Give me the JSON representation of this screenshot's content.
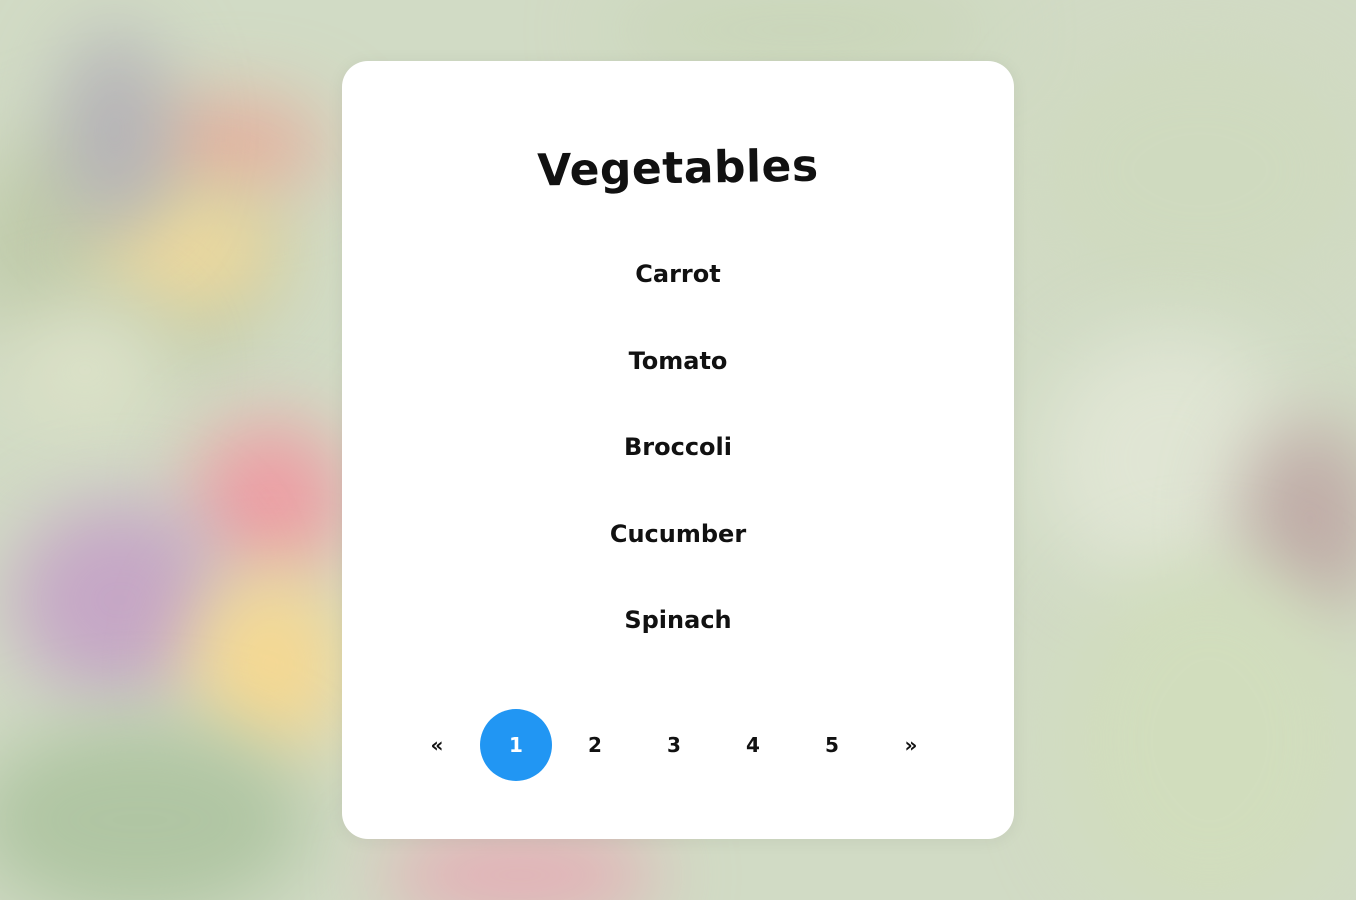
{
  "colors": {
    "accent": "#2196f3",
    "card_background": "#ffffff",
    "text": "#111111"
  },
  "card": {
    "title": "Vegetables",
    "items": [
      "Carrot",
      "Tomato",
      "Broccoli",
      "Cucumber",
      "Spinach"
    ]
  },
  "pagination": {
    "prev_label": "«",
    "next_label": "»",
    "pages": [
      "1",
      "2",
      "3",
      "4",
      "5"
    ],
    "current_page": "1"
  }
}
